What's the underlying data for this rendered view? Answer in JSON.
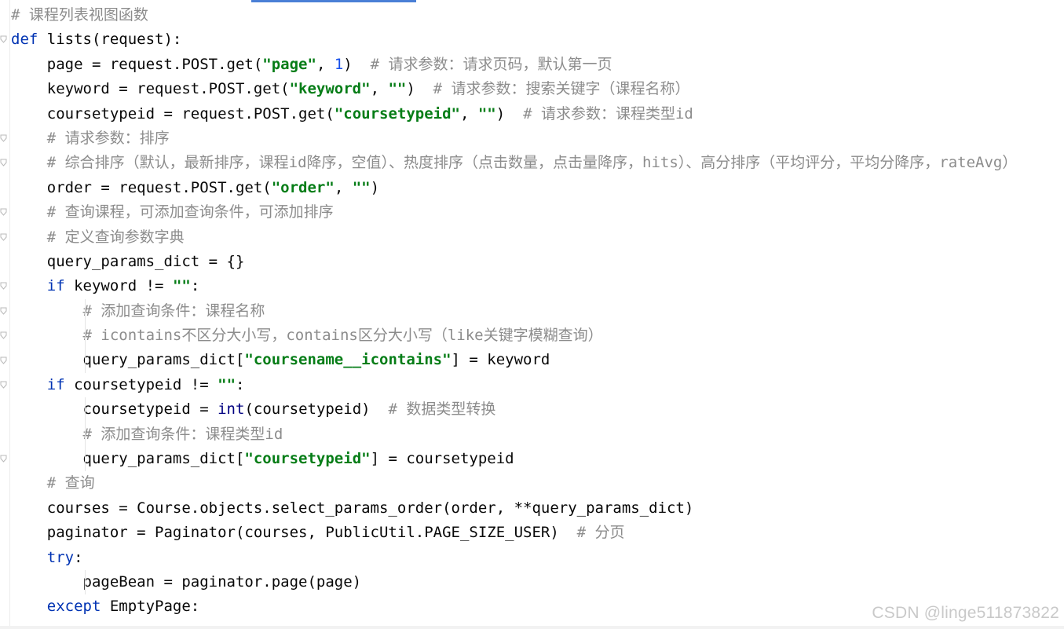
{
  "editor": {
    "language": "python",
    "watermark": "CSDN @linge511873822",
    "colors": {
      "keyword": "#0033b3",
      "string": "#067d17",
      "number": "#1750eb",
      "comment": "#8c8c8c",
      "text": "#080808",
      "tab_indicator": "#4a7fd6"
    },
    "lines": [
      [
        {
          "t": "# 课程列表视图函数",
          "c": "cmt"
        }
      ],
      [
        {
          "t": "def",
          "c": "kw"
        },
        {
          "t": " lists(request):",
          "c": ""
        }
      ],
      [
        {
          "t": "    page = request.POST.get(",
          "c": ""
        },
        {
          "t": "\"page\"",
          "c": "str"
        },
        {
          "t": ", ",
          "c": ""
        },
        {
          "t": "1",
          "c": "num"
        },
        {
          "t": ")  ",
          "c": ""
        },
        {
          "t": "# 请求参数：请求页码，默认第一页",
          "c": "cmt"
        }
      ],
      [
        {
          "t": "    keyword = request.POST.get(",
          "c": ""
        },
        {
          "t": "\"keyword\"",
          "c": "str"
        },
        {
          "t": ", ",
          "c": ""
        },
        {
          "t": "\"\"",
          "c": "str"
        },
        {
          "t": ")  ",
          "c": ""
        },
        {
          "t": "# 请求参数：搜索关键字（课程名称）",
          "c": "cmt"
        }
      ],
      [
        {
          "t": "    coursetypeid = request.POST.get(",
          "c": ""
        },
        {
          "t": "\"coursetypeid\"",
          "c": "str"
        },
        {
          "t": ", ",
          "c": ""
        },
        {
          "t": "\"\"",
          "c": "str"
        },
        {
          "t": ")  ",
          "c": ""
        },
        {
          "t": "# 请求参数：课程类型id",
          "c": "cmt"
        }
      ],
      [
        {
          "t": "    ",
          "c": ""
        },
        {
          "t": "# 请求参数：排序",
          "c": "cmt"
        }
      ],
      [
        {
          "t": "    ",
          "c": ""
        },
        {
          "t": "# 综合排序（默认，最新排序，课程id降序，空值）、热度排序（点击数量，点击量降序，hits）、高分排序（平均评分，平均分降序，rateAvg）",
          "c": "cmt"
        }
      ],
      [
        {
          "t": "    order = request.POST.get(",
          "c": ""
        },
        {
          "t": "\"order\"",
          "c": "str"
        },
        {
          "t": ", ",
          "c": ""
        },
        {
          "t": "\"\"",
          "c": "str"
        },
        {
          "t": ")",
          "c": ""
        }
      ],
      [
        {
          "t": "    ",
          "c": ""
        },
        {
          "t": "# 查询课程，可添加查询条件，可添加排序",
          "c": "cmt"
        }
      ],
      [
        {
          "t": "    ",
          "c": ""
        },
        {
          "t": "# 定义查询参数字典",
          "c": "cmt"
        }
      ],
      [
        {
          "t": "    query_params_dict = {}",
          "c": ""
        }
      ],
      [
        {
          "t": "    ",
          "c": ""
        },
        {
          "t": "if",
          "c": "kw"
        },
        {
          "t": " keyword != ",
          "c": ""
        },
        {
          "t": "\"\"",
          "c": "str"
        },
        {
          "t": ":",
          "c": ""
        }
      ],
      [
        {
          "t": "        ",
          "c": ""
        },
        {
          "t": "# 添加查询条件：课程名称",
          "c": "cmt"
        }
      ],
      [
        {
          "t": "        ",
          "c": ""
        },
        {
          "t": "# icontains不区分大小写，contains区分大小写（like关键字模糊查询）",
          "c": "cmt"
        }
      ],
      [
        {
          "t": "        query_params_dict[",
          "c": ""
        },
        {
          "t": "\"coursename__icontains\"",
          "c": "str"
        },
        {
          "t": "] = keyword",
          "c": ""
        }
      ],
      [
        {
          "t": "    ",
          "c": ""
        },
        {
          "t": "if",
          "c": "kw"
        },
        {
          "t": " coursetypeid != ",
          "c": ""
        },
        {
          "t": "\"\"",
          "c": "str"
        },
        {
          "t": ":",
          "c": ""
        }
      ],
      [
        {
          "t": "        coursetypeid = ",
          "c": ""
        },
        {
          "t": "int",
          "c": "builtin"
        },
        {
          "t": "(coursetypeid)  ",
          "c": ""
        },
        {
          "t": "# 数据类型转换",
          "c": "cmt"
        }
      ],
      [
        {
          "t": "        ",
          "c": ""
        },
        {
          "t": "# 添加查询条件：课程类型id",
          "c": "cmt"
        }
      ],
      [
        {
          "t": "        query_params_dict[",
          "c": ""
        },
        {
          "t": "\"coursetypeid\"",
          "c": "str"
        },
        {
          "t": "] = coursetypeid",
          "c": ""
        }
      ],
      [
        {
          "t": "    ",
          "c": ""
        },
        {
          "t": "# 查询",
          "c": "cmt"
        }
      ],
      [
        {
          "t": "    courses = Course.objects.select_params_order(order, **query_params_dict)",
          "c": ""
        }
      ],
      [
        {
          "t": "    paginator = Paginator(courses, PublicUtil.PAGE_SIZE_USER)  ",
          "c": ""
        },
        {
          "t": "# 分页",
          "c": "cmt"
        }
      ],
      [
        {
          "t": "    ",
          "c": ""
        },
        {
          "t": "try",
          "c": "kw"
        },
        {
          "t": ":",
          "c": ""
        }
      ],
      [
        {
          "t": "        pageBean = paginator.page(page)",
          "c": ""
        }
      ],
      [
        {
          "t": "    ",
          "c": ""
        },
        {
          "t": "except",
          "c": "kw"
        },
        {
          "t": " EmptyPage:",
          "c": ""
        }
      ]
    ],
    "fold_markers": [
      1,
      5,
      6,
      8,
      9,
      11,
      12,
      13,
      14,
      15,
      18
    ]
  }
}
